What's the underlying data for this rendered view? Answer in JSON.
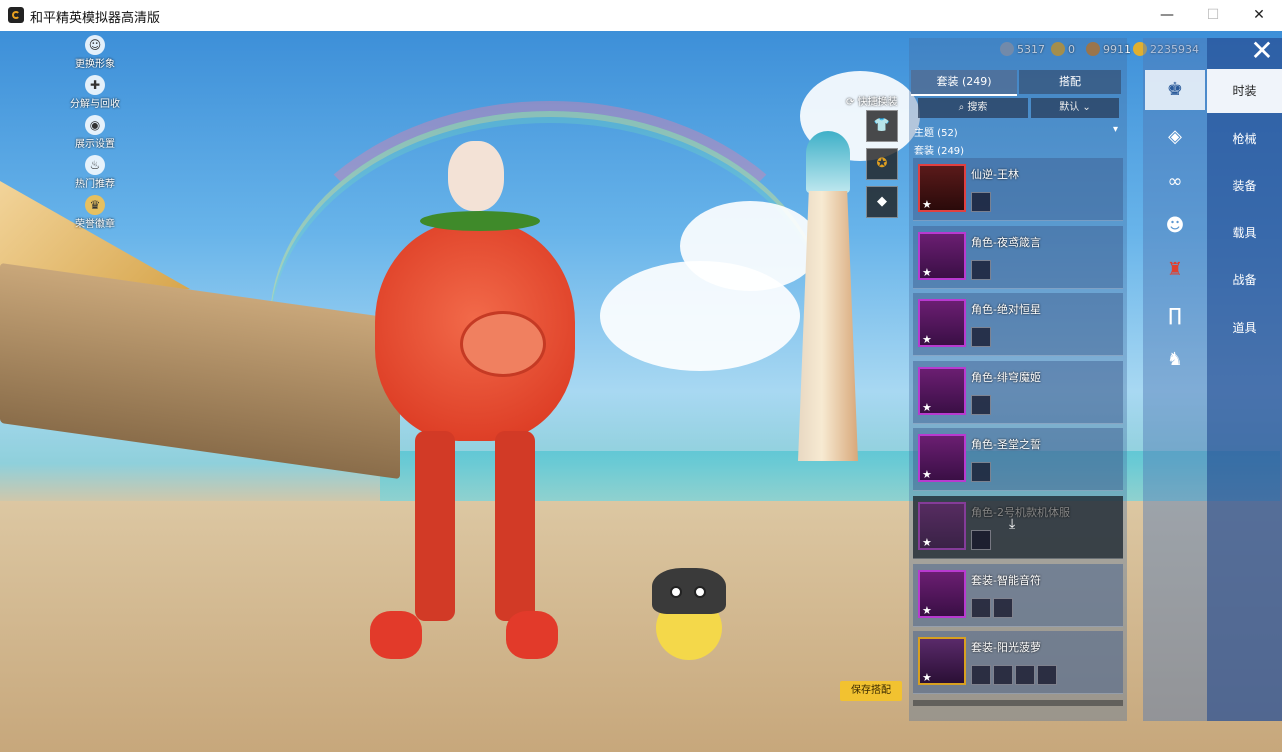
{
  "window": {
    "title": "和平精英模拟器高清版",
    "controls": {
      "minimize": "—",
      "maximize": "☐",
      "close": "✕"
    }
  },
  "left_menu": [
    {
      "label": "更换形象",
      "icon": "person-icon"
    },
    {
      "label": "分解与回收",
      "icon": "recycle-icon"
    },
    {
      "label": "展示设置",
      "icon": "eye-icon"
    },
    {
      "label": "热门推荐",
      "icon": "fire-icon"
    },
    {
      "label": "荣誉徽章",
      "icon": "badge-icon"
    }
  ],
  "currency": [
    {
      "value": "5317",
      "color": "#8a9ab0"
    },
    {
      "value": "0",
      "color": "#d8a020"
    },
    {
      "value": "9911",
      "color": "#c87a20"
    },
    {
      "value": "2235934",
      "color": "#e0b030"
    }
  ],
  "quick_change": {
    "label": "快捷换装"
  },
  "panel": {
    "tabs": [
      "套装 (249)",
      "搭配"
    ],
    "search_label": "搜索",
    "sort_value": "默认",
    "filter_theme": "主题 (52)",
    "filter_suit": "套装 (249)",
    "items": [
      {
        "name": "仙逆-王林"
      },
      {
        "name": "角色-夜鸢箴言"
      },
      {
        "name": "角色-绝对恒星"
      },
      {
        "name": "角色-绯穹魔姬"
      },
      {
        "name": "角色-圣堂之誓"
      },
      {
        "name": "角色-2号机款机体服"
      },
      {
        "name": "套装-智能音符"
      },
      {
        "name": "套装-阳光菠萝"
      }
    ],
    "save_button": "保存搭配"
  },
  "categories": [
    {
      "icon": "outfit-icon"
    },
    {
      "icon": "bag-icon"
    },
    {
      "icon": "glasses-icon"
    },
    {
      "icon": "mask-icon"
    },
    {
      "icon": "shirt-icon"
    },
    {
      "icon": "pants-icon"
    },
    {
      "icon": "shoes-icon"
    }
  ],
  "right_tabs": [
    "时装",
    "枪械",
    "装备",
    "载具",
    "战备",
    "道具"
  ],
  "colors": {
    "accent": "#f2c230",
    "panel_blue": "#28508f"
  }
}
